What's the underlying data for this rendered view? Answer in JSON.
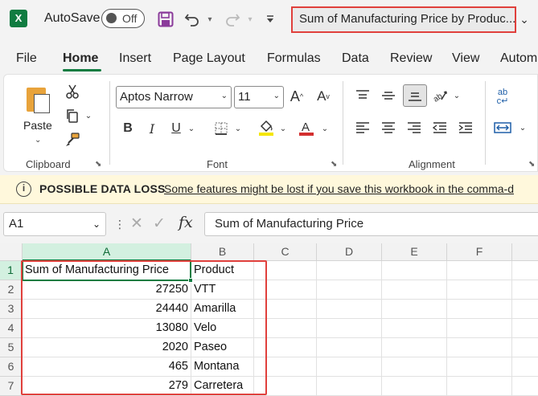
{
  "app": {
    "logo_letter": "X",
    "autosave_label": "AutoSave",
    "autosave_state": "Off",
    "document_title": "Sum of Manufacturing Price by Produc..."
  },
  "tabs": [
    {
      "label": "File"
    },
    {
      "label": "Home"
    },
    {
      "label": "Insert"
    },
    {
      "label": "Page Layout"
    },
    {
      "label": "Formulas"
    },
    {
      "label": "Data"
    },
    {
      "label": "Review"
    },
    {
      "label": "View"
    },
    {
      "label": "Autom"
    }
  ],
  "ribbon": {
    "clipboard": {
      "paste_label": "Paste",
      "group_label": "Clipboard"
    },
    "font": {
      "font_name": "Aptos Narrow",
      "font_size": "11",
      "group_label": "Font",
      "bold": "B",
      "italic": "I",
      "underline": "U"
    },
    "alignment": {
      "group_label": "Alignment",
      "wrap_icon_text": "ab→c"
    }
  },
  "infobar": {
    "title": "POSSIBLE DATA LOSS",
    "message": "Some features might be lost if you save this workbook in the comma-d"
  },
  "formula_bar": {
    "name_box": "A1",
    "fx": "fx",
    "content": "Sum of Manufacturing Price"
  },
  "grid": {
    "columns": [
      "A",
      "B",
      "C",
      "D",
      "E",
      "F"
    ],
    "rows": [
      "1",
      "2",
      "3",
      "4",
      "5",
      "6",
      "7"
    ],
    "cells": [
      [
        "Sum of Manufacturing Price",
        "Product"
      ],
      [
        "27250",
        "VTT"
      ],
      [
        "24440",
        "Amarilla"
      ],
      [
        "13080",
        "Velo"
      ],
      [
        "2020",
        "Paseo"
      ],
      [
        "465",
        "Montana"
      ],
      [
        "279",
        "Carretera"
      ]
    ]
  },
  "colors": {
    "accent": "#107c41",
    "highlight_box": "#e0403c",
    "infobar_bg": "#fff8dc"
  }
}
